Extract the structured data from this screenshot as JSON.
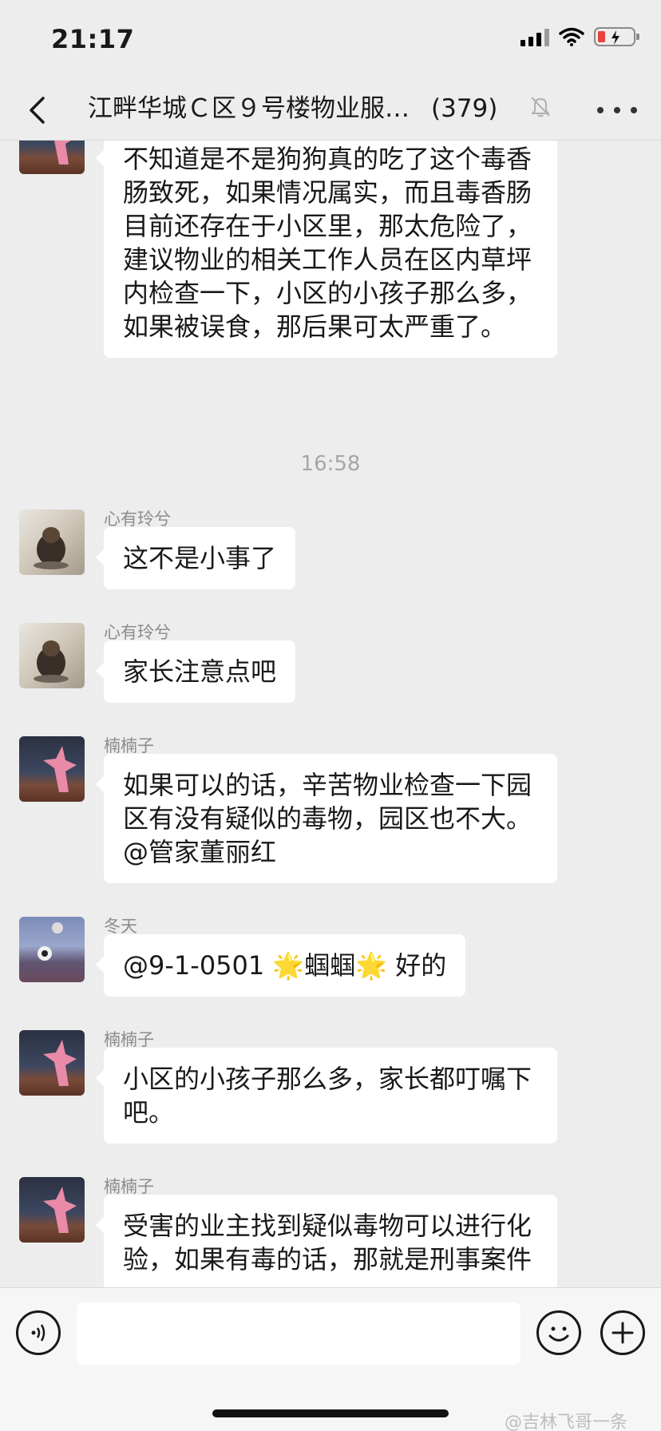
{
  "status_bar": {
    "time": "21:17"
  },
  "nav": {
    "title": "江畔华城Ｃ区９号楼物业服…",
    "member_count": "(379)"
  },
  "messages": [
    {
      "sender": "",
      "avatar": "starfish-avatar",
      "text": "不知道是不是狗狗真的吃了这个毒香肠致死，如果情况属实，而且毒香肠目前还存在于小区里，那太危险了，建议物业的相关工作人员在区内草坪内检查一下，小区的小孩子那么多，如果被误食，那后果可太严重了。"
    },
    {
      "sender": "心有玲兮",
      "avatar": "dog-avatar",
      "text": "这不是小事了"
    },
    {
      "sender": "心有玲兮",
      "avatar": "dog-avatar",
      "text": "家长注意点吧"
    },
    {
      "sender": "楠楠子",
      "avatar": "starfish-avatar",
      "text": "如果可以的话，辛苦物业检查一下园区有没有疑似的毒物，园区也不大。@管家董丽红"
    },
    {
      "sender": "冬天",
      "avatar": "winter-avatar",
      "text": "@9-1-0501 🌟蝈蝈🌟 好的"
    },
    {
      "sender": "楠楠子",
      "avatar": "starfish-avatar",
      "text": "小区的小孩子那么多，家长都叮嘱下吧。"
    },
    {
      "sender": "楠楠子",
      "avatar": "starfish-avatar",
      "text": "受害的业主找到疑似毒物可以进行化验，如果有毒的话，那就是刑事案件"
    }
  ],
  "timestamp": "16:58",
  "input": {
    "placeholder": ""
  },
  "watermark": "@吉林飞哥一条",
  "colors": {
    "background": "#ededed",
    "bubble": "#ffffff",
    "battery_low": "#e64340"
  }
}
